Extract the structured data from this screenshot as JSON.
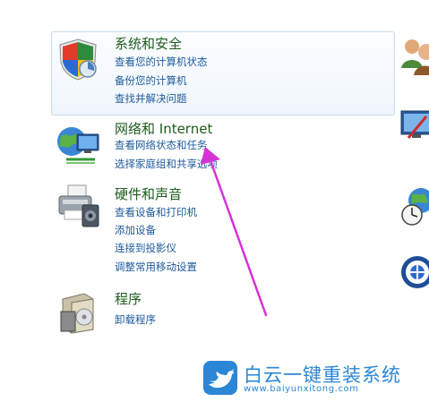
{
  "categories": [
    {
      "title": "系统和安全",
      "icon": "shield-icon",
      "links": [
        "查看您的计算机状态",
        "备份您的计算机",
        "查找并解决问题"
      ]
    },
    {
      "title": "网络和 Internet",
      "icon": "network-globe-icon",
      "links": [
        "查看网络状态和任务",
        "选择家庭组和共享选项"
      ]
    },
    {
      "title": "硬件和声音",
      "icon": "printer-icon",
      "links": [
        "查看设备和打印机",
        "添加设备",
        "连接到投影仪",
        "调整常用移动设置"
      ]
    },
    {
      "title": "程序",
      "icon": "programs-box-icon",
      "links": [
        "卸载程序"
      ]
    }
  ],
  "side_icons": [
    "user-accounts-icon",
    "appearance-icon",
    "clock-region-icon",
    "ease-of-access-icon"
  ],
  "watermark": {
    "brand_text": "白云一键重装系统",
    "url": "www.baiyunxitong.com",
    "logo": "bird-logo-icon"
  },
  "colors": {
    "title_green": "#1e5c1e",
    "link_blue": "#1d5a9c",
    "highlight_border": "#c7dcec",
    "arrow_magenta": "#d532d5",
    "watermark_blue": "#2b86d6"
  }
}
